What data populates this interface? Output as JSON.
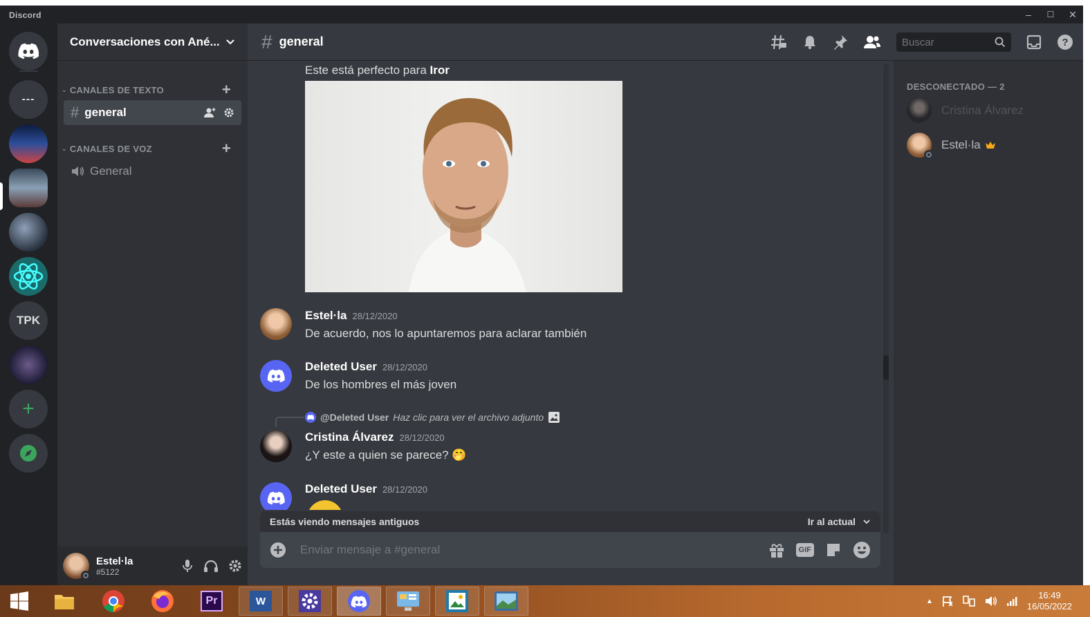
{
  "window": {
    "title": "Discord",
    "controls": [
      "–",
      "☐",
      "✕"
    ]
  },
  "servers": {
    "home_label": "Discord",
    "dots_label": "---",
    "tpk_label": "TPK",
    "add_label": "+"
  },
  "guild": {
    "name": "Conversaciones con Ané..."
  },
  "sidebar": {
    "text_category": "CANALES DE TEXTO",
    "voice_category": "CANALES DE VOZ",
    "channels": [
      {
        "hash": "#",
        "name": "general"
      }
    ],
    "voice_channels": [
      {
        "name": "General"
      }
    ]
  },
  "user": {
    "name": "Estel·la",
    "tag": "#5122"
  },
  "header": {
    "hash": "#",
    "channel": "general",
    "search_placeholder": "Buscar"
  },
  "messages": {
    "caption_prefix": "Este está perfecto para ",
    "caption_bold": "Iror",
    "m1": {
      "author": "Estel·la",
      "time": "28/12/2020",
      "text": "De acuerdo, nos lo apuntaremos para aclarar también"
    },
    "m2": {
      "author": "Deleted User",
      "time": "28/12/2020",
      "text": "De los hombres el más joven"
    },
    "reply": {
      "mention": "@Deleted User",
      "hint": "Haz clic para ver el archivo adjunto"
    },
    "m3": {
      "author": "Cristina Álvarez",
      "time": "28/12/2020",
      "text": "¿Y este a quien se parece? 🤭"
    },
    "m4": {
      "author": "Deleted User",
      "time": "28/12/2020"
    }
  },
  "old_messages_bar": {
    "text": "Estás viendo mensajes antiguos",
    "jump": "Ir al actual"
  },
  "composer": {
    "placeholder": "Enviar mensaje a #general",
    "gif_label": "GIF"
  },
  "members": {
    "category": "DESCONECTADO — 2",
    "list": [
      {
        "name": "Cristina Álvarez"
      },
      {
        "name": "Estel·la"
      }
    ]
  },
  "taskbar": {
    "time": "16:49",
    "date": "16/05/2022",
    "pr_label": "Pr",
    "word_label": "W"
  },
  "colors": {
    "blurple": "#5865f2",
    "green": "#3ba55d",
    "bg": "#36393f"
  }
}
